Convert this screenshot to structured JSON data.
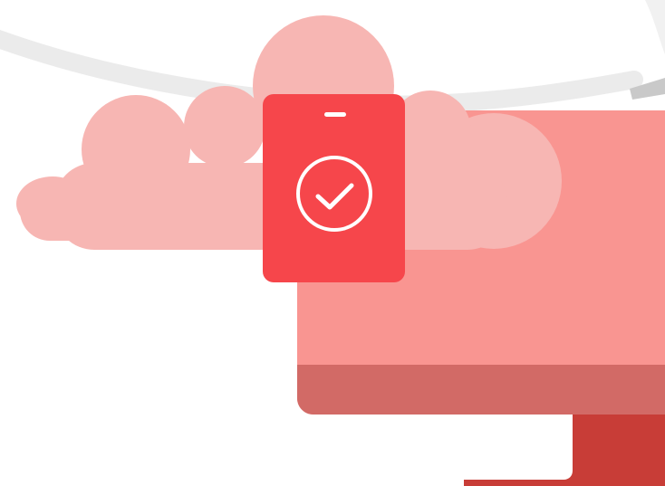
{
  "illustration": {
    "subject": "cloud-sync-verified-device",
    "icons": [
      "cloud-icon",
      "monitor-icon",
      "phone-icon",
      "check-circle-icon"
    ],
    "colors": {
      "background": "#ffffff",
      "arc": "#ebebeb",
      "arc_end": "#c9c9c9",
      "cloud": "#f7b6b3",
      "monitor_screen": "#f99591",
      "monitor_bezel": "#d26a66",
      "monitor_stand": "#c83d37",
      "phone_body": "#f6464b",
      "phone_detail": "#ffffff"
    }
  }
}
